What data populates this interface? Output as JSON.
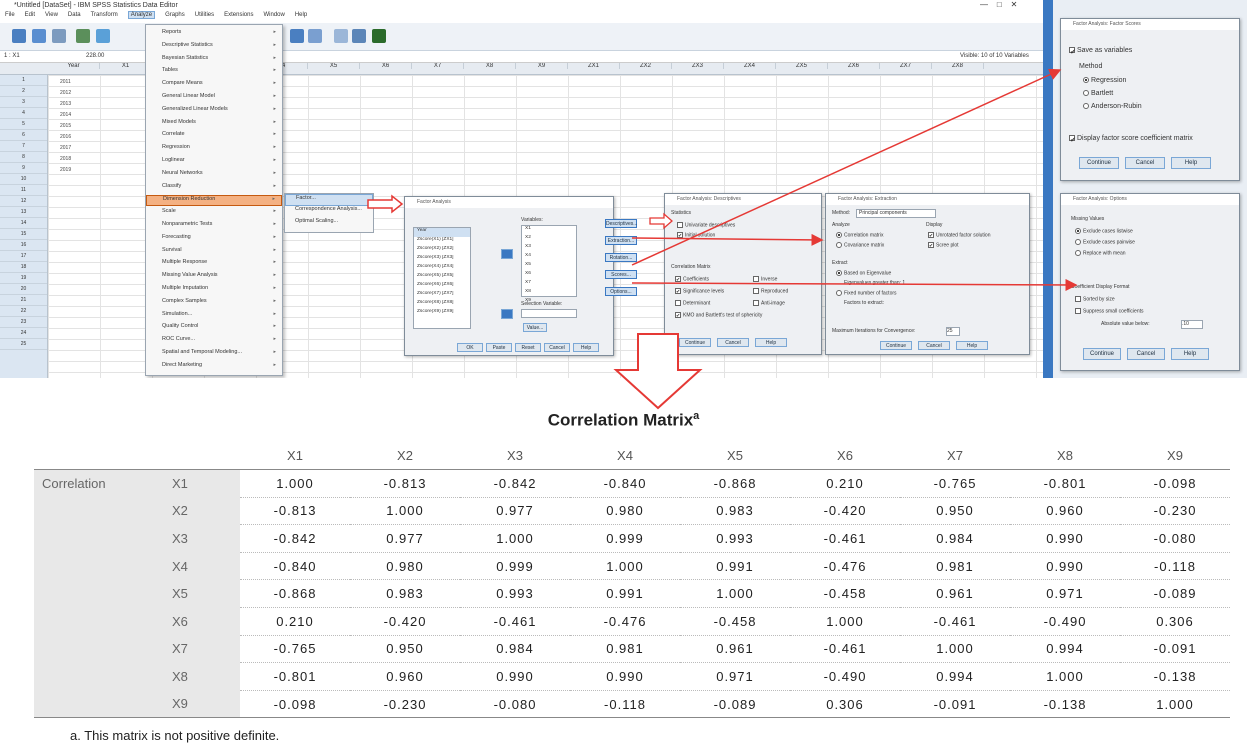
{
  "spss": {
    "title": "*Untitled [DataSet] - IBM SPSS Statistics Data Editor",
    "window_controls": [
      "—",
      "□",
      "✕"
    ],
    "menus": [
      "File",
      "Edit",
      "View",
      "Data",
      "Transform",
      "Analyze",
      "Graphs",
      "Utilities",
      "Extensions",
      "Window",
      "Help"
    ],
    "active_menu": "Analyze",
    "cell_ref": "1 : X1",
    "cell_value": "228.00",
    "visible_info": "Visible: 10 of 10 Variables",
    "columns": [
      "Year",
      "X1",
      "X2",
      "X3",
      "X4",
      "X5",
      "X6",
      "X7",
      "X8",
      "X9",
      "ZX1",
      "ZX2",
      "ZX3",
      "ZX4",
      "ZX5",
      "ZX6",
      "ZX7",
      "ZX8"
    ],
    "rows": [
      "1",
      "2",
      "3",
      "4",
      "5",
      "6",
      "7",
      "8",
      "9",
      "10",
      "11",
      "12",
      "13",
      "14",
      "15",
      "16",
      "17",
      "18",
      "19",
      "20",
      "21",
      "22",
      "23",
      "24",
      "25"
    ],
    "data_years": [
      "2011",
      "2012",
      "2013",
      "2014",
      "2015",
      "2016",
      "2017",
      "2018",
      "2019"
    ],
    "analyze_menu": [
      "Reports",
      "Descriptive Statistics",
      "Bayesian Statistics",
      "Tables",
      "Compare Means",
      "General Linear Model",
      "Generalized Linear Models",
      "Mixed Models",
      "Correlate",
      "Regression",
      "Loglinear",
      "Neural Networks",
      "Classify",
      "Dimension Reduction",
      "Scale",
      "Nonparametric Tests",
      "Forecasting",
      "Survival",
      "Multiple Response",
      "Missing Value Analysis",
      "Multiple Imputation",
      "Complex Samples",
      "Simulation...",
      "Quality Control",
      "ROC Curve...",
      "Spatial and Temporal Modeling...",
      "Direct Marketing"
    ],
    "highlight_item": "Dimension Reduction",
    "submenu": [
      "Factor...",
      "Correspondence Analysis...",
      "Optimal Scaling..."
    ],
    "factor_dialog": {
      "title": "Factor Analysis",
      "variables_label": "Variables:",
      "selection_label": "Selection Variable:",
      "value_btn": "Value...",
      "side_buttons": [
        "Descriptives...",
        "Extraction...",
        "Rotation...",
        "Scores...",
        "Options..."
      ],
      "buttons": [
        "OK",
        "Paste",
        "Reset",
        "Cancel",
        "Help"
      ],
      "source_vars": [
        "Year",
        "Zscore(X1) [ZX1]",
        "Zscore(X2) [ZX2]",
        "Zscore(X3) [ZX3]",
        "Zscore(X4) [ZX4]",
        "Zscore(X5) [ZX5]",
        "Zscore(X6) [ZX6]",
        "Zscore(X7) [ZX7]",
        "Zscore(X8) [ZX8]",
        "Zscore(X9) [ZX9]"
      ],
      "target_vars": [
        "X1",
        "X2",
        "X3",
        "X4",
        "X5",
        "X6",
        "X7",
        "X8",
        "X9"
      ]
    },
    "descriptives_dialog": {
      "title": "Factor Analysis: Descriptives",
      "statistics_label": "Statistics",
      "stats": [
        "Univariate descriptives",
        "Initial solution"
      ],
      "matrix_label": "Correlation Matrix",
      "matrix_items": [
        "Coefficients",
        "Inverse",
        "Significance levels",
        "Reproduced",
        "Determinant",
        "Anti-image",
        "KMO and Bartlett's test of sphericity"
      ],
      "buttons": [
        "Continue",
        "Cancel",
        "Help"
      ]
    },
    "extraction_dialog": {
      "title": "Factor Analysis: Extraction",
      "method_label": "Method:",
      "method_value": "Principal components",
      "analyze_label": "Analyze",
      "analyze_opts": [
        "Correlation matrix",
        "Covariance matrix"
      ],
      "display_label": "Display",
      "display_opts": [
        "Unrotated factor solution",
        "Scree plot"
      ],
      "extract_label": "Extract",
      "extract_opts": [
        "Based on Eigenvalue",
        "Fixed number of factors"
      ],
      "eig_text": "Eigenvalues greater than: 1",
      "factors_text": "Factors to extract:",
      "maxiter_label": "Maximum Iterations for Convergence:",
      "maxiter_value": "25",
      "buttons": [
        "Continue",
        "Cancel",
        "Help"
      ]
    },
    "scores_dialog": {
      "title": "Factor Analysis: Factor Scores",
      "save_label": "Save as variables",
      "method_label": "Method",
      "methods": [
        "Regression",
        "Bartlett",
        "Anderson-Rubin"
      ],
      "display_label": "Display factor score coefficient matrix",
      "buttons": [
        "Continue",
        "Cancel",
        "Help"
      ]
    },
    "options_dialog": {
      "title": "Factor Analysis: Options",
      "missing_label": "Missing Values",
      "missing_opts": [
        "Exclude cases listwise",
        "Exclude cases pairwise",
        "Replace with mean"
      ],
      "coef_label": "Coefficient Display Format",
      "coef_opts": [
        "Sorted by size",
        "Suppress small coefficients"
      ],
      "abs_label": "Absolute value below:",
      "abs_value": ".10",
      "buttons": [
        "Continue",
        "Cancel",
        "Help"
      ]
    }
  },
  "matrix": {
    "title": "Correlation Matrix",
    "title_sup": "a",
    "row_group": "Correlation",
    "headers": [
      "X1",
      "X2",
      "X3",
      "X4",
      "X5",
      "X6",
      "X7",
      "X8",
      "X9"
    ],
    "rows": [
      {
        "label": "X1",
        "values": [
          "1.000",
          "-0.813",
          "-0.842",
          "-0.840",
          "-0.868",
          "0.210",
          "-0.765",
          "-0.801",
          "-0.098"
        ]
      },
      {
        "label": "X2",
        "values": [
          "-0.813",
          "1.000",
          "0.977",
          "0.980",
          "0.983",
          "-0.420",
          "0.950",
          "0.960",
          "-0.230"
        ]
      },
      {
        "label": "X3",
        "values": [
          "-0.842",
          "0.977",
          "1.000",
          "0.999",
          "0.993",
          "-0.461",
          "0.984",
          "0.990",
          "-0.080"
        ]
      },
      {
        "label": "X4",
        "values": [
          "-0.840",
          "0.980",
          "0.999",
          "1.000",
          "0.991",
          "-0.476",
          "0.981",
          "0.990",
          "-0.118"
        ]
      },
      {
        "label": "X5",
        "values": [
          "-0.868",
          "0.983",
          "0.993",
          "0.991",
          "1.000",
          "-0.458",
          "0.961",
          "0.971",
          "-0.089"
        ]
      },
      {
        "label": "X6",
        "values": [
          "0.210",
          "-0.420",
          "-0.461",
          "-0.476",
          "-0.458",
          "1.000",
          "-0.461",
          "-0.490",
          "0.306"
        ]
      },
      {
        "label": "X7",
        "values": [
          "-0.765",
          "0.950",
          "0.984",
          "0.981",
          "0.961",
          "-0.461",
          "1.000",
          "0.994",
          "-0.091"
        ]
      },
      {
        "label": "X8",
        "values": [
          "-0.801",
          "0.960",
          "0.990",
          "0.990",
          "0.971",
          "-0.490",
          "0.994",
          "1.000",
          "-0.138"
        ]
      },
      {
        "label": "X9",
        "values": [
          "-0.098",
          "-0.230",
          "-0.080",
          "-0.118",
          "-0.089",
          "0.306",
          "-0.091",
          "-0.138",
          "1.000"
        ]
      }
    ],
    "footnote": "a. This matrix is not positive definite."
  },
  "colors": {
    "arrow_red": "#e53935",
    "highlight_orange": "#f4b183",
    "spss_blue": "#3a78c2"
  }
}
